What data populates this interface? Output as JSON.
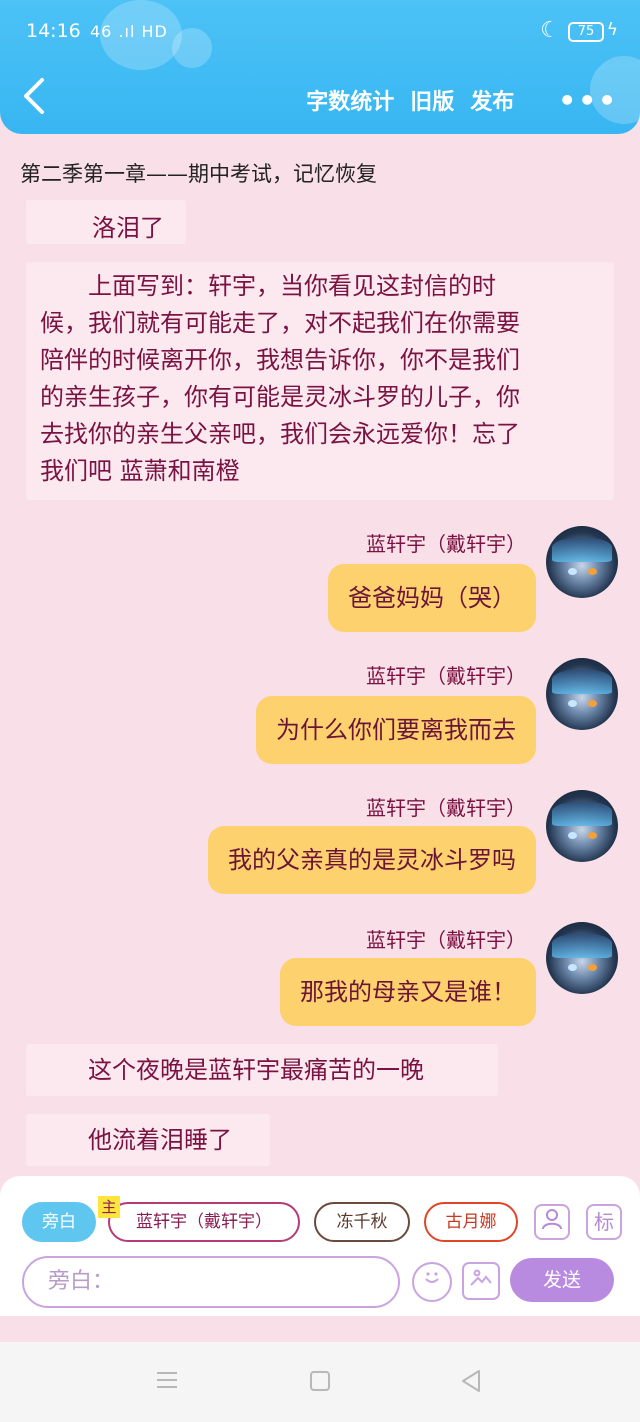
{
  "status_bar": {
    "time": "14:16",
    "network": "46 .ıl HD",
    "battery": "75"
  },
  "header": {
    "back_icon": "chevron-left-icon",
    "actions": [
      "字数统计",
      "旧版",
      "发布"
    ],
    "more_icon": "more-dots-icon",
    "more_label": "•••",
    "colors": {
      "accent": "#38b6f2"
    }
  },
  "chapter_title": "第二季第一章——期中考试，记忆恢复",
  "messages": {
    "narration_1": "洛泪了",
    "narration_2_lines": [
      "　　上面写到：轩宇，当你看见这封信的时",
      "候，我们就有可能走了，对不起我们在你需要",
      "陪伴的时候离开你，我想告诉你，你不是我们",
      "的亲生孩子，你有可能是灵冰斗罗的儿子，你",
      "去找你的亲生父亲吧，我们会永远爱你！忘了",
      "我们吧 蓝萧和南橙"
    ],
    "speaker_name": "蓝轩宇（戴轩宇）",
    "bubble_1": "爸爸妈妈（哭）",
    "bubble_2": "为什么你们要离我而去",
    "bubble_3": "我的父亲真的是灵冰斗罗吗",
    "bubble_4": "那我的母亲又是谁！",
    "narration_3": "　　这个夜晚是蓝轩宇最痛苦的一晚",
    "narration_4": "　　他流着泪睡了"
  },
  "input_panel": {
    "chips": {
      "aside": "旁白",
      "main_tag": "主",
      "main": "蓝轩宇（戴轩宇）",
      "c2": "冻千秋",
      "c3": "古月娜"
    },
    "role_icon": "person-card-icon",
    "tag_label": "标",
    "placeholder": "旁白：",
    "emoji_icon": "smiley-icon",
    "image_icon": "image-icon",
    "send_label": "发送"
  },
  "system_nav": {
    "menu_icon": "menu-icon",
    "home_icon": "square-icon",
    "back_icon": "triangle-back-icon"
  }
}
